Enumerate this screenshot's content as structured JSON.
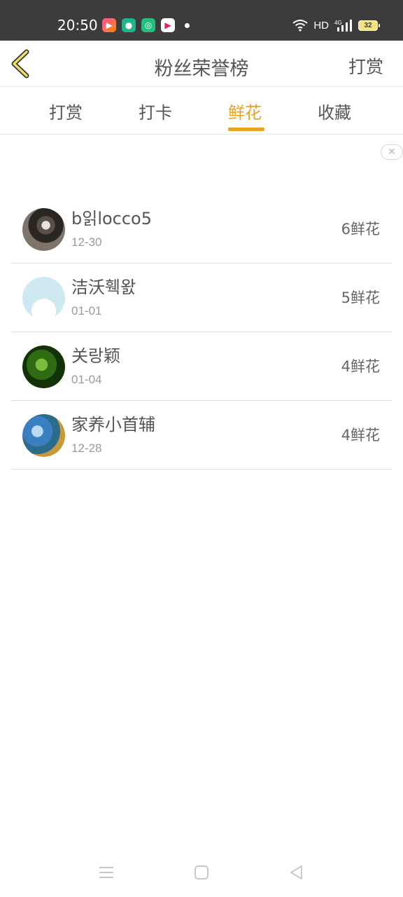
{
  "status_bar": {
    "time": "20:50",
    "network_label": "HD",
    "signal_label": "4G",
    "battery_level": "32",
    "app_icons": [
      "video-app-icon",
      "shopping-app-icon",
      "circle-app-icon",
      "media-app-icon"
    ]
  },
  "header": {
    "title": "粉丝荣誉榜",
    "action_label": "打赏",
    "back_icon": "chevron-left-icon"
  },
  "tabs": [
    {
      "label": "打赏",
      "active": false
    },
    {
      "label": "打卡",
      "active": false
    },
    {
      "label": "鲜花",
      "active": true
    },
    {
      "label": "收藏",
      "active": false
    }
  ],
  "close_ad_glyph": "✕",
  "ranking": [
    {
      "name": "b읽locco5",
      "date": "12-30",
      "count": "6鲜花"
    },
    {
      "name": "洁沃훽왌",
      "date": "01-01",
      "count": "5鲜花"
    },
    {
      "name": "关랑颖",
      "date": "01-04",
      "count": "4鲜花"
    },
    {
      "name": "家养小首辅",
      "date": "12-28",
      "count": "4鲜花"
    }
  ],
  "colors": {
    "accent": "#f0a020",
    "status_bar": "#3c3c3c",
    "text": "#555555",
    "subtext": "#999999"
  },
  "bottom_nav": [
    "menu-icon",
    "home-icon",
    "back-triangle-icon"
  ]
}
